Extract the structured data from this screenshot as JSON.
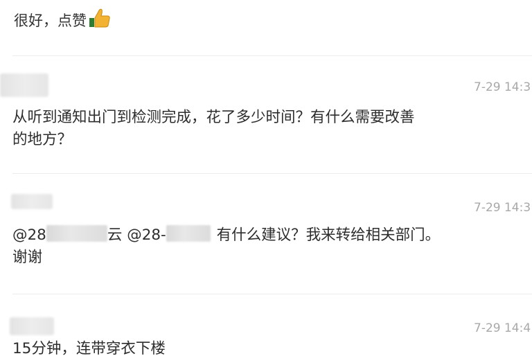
{
  "top": {
    "text": "很好，点赞"
  },
  "comments": [
    {
      "time": "7-29 14:3",
      "line1": "从听到通知出门到检测完成，花了多少时间？有什么需要改善",
      "line2": "的地方？"
    },
    {
      "time": "7-29 14:3",
      "mention1": "@28",
      "mention1_tail": "云 @28-",
      "text": " 有什么建议？我来转给相关部门。",
      "line2": "谢谢"
    },
    {
      "time": "7-29 14:4",
      "line1": "15分钟，连带穿衣下楼"
    }
  ],
  "colors": {
    "text": "#2d2d2d",
    "time": "#a8a8a8",
    "divider": "#ececec",
    "thumb": "#f2b233"
  }
}
